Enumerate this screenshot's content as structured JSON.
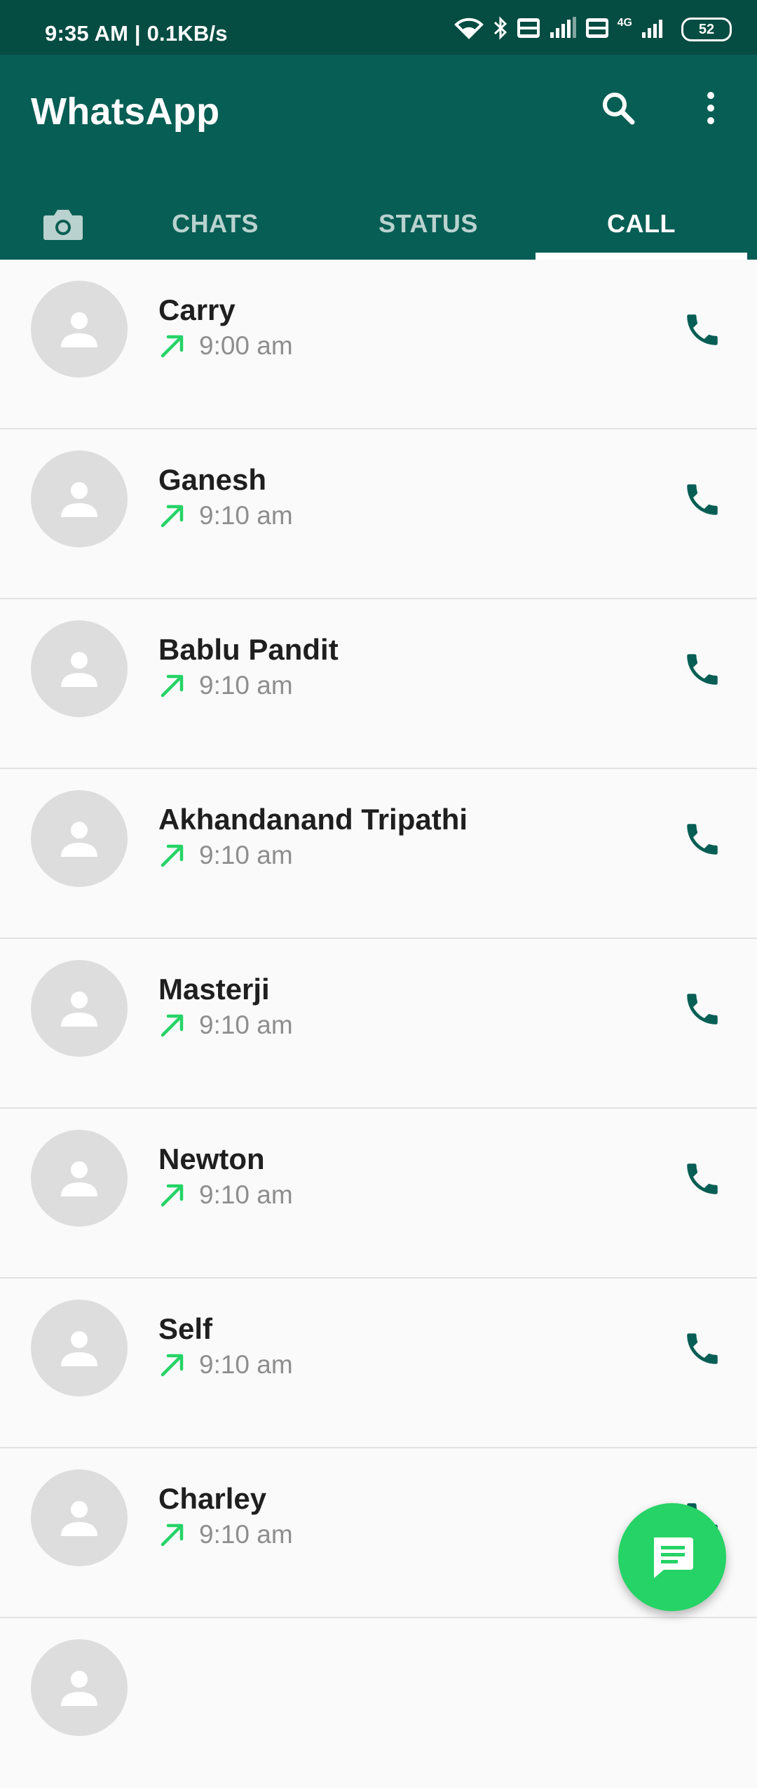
{
  "status_bar": {
    "time_speed": "9:35 AM | 0.1KB/s",
    "network_label": "4G",
    "battery": "52"
  },
  "app_bar": {
    "title": "WhatsApp",
    "tabs": [
      {
        "label": "CHATS",
        "active": false
      },
      {
        "label": "STATUS",
        "active": false
      },
      {
        "label": "CALL",
        "active": true
      }
    ]
  },
  "calls": [
    {
      "name": "Carry",
      "time": "9:00 am",
      "direction": "outgoing-arrow-icon"
    },
    {
      "name": "Ganesh",
      "time": "9:10 am",
      "direction": "outgoing-arrow-icon"
    },
    {
      "name": "Bablu Pandit",
      "time": "9:10 am",
      "direction": "outgoing-arrow-icon"
    },
    {
      "name": "Akhandanand Tripathi",
      "time": "9:10 am",
      "direction": "outgoing-arrow-icon"
    },
    {
      "name": "Masterji",
      "time": "9:10 am",
      "direction": "outgoing-arrow-icon"
    },
    {
      "name": "Newton",
      "time": "9:10 am",
      "direction": "outgoing-arrow-icon"
    },
    {
      "name": "Self",
      "time": "9:10 am",
      "direction": "outgoing-arrow-icon"
    },
    {
      "name": "Charley",
      "time": "9:10 am",
      "direction": "outgoing-arrow-icon"
    }
  ],
  "colors": {
    "status_bar": "#054c42",
    "app_bar": "#075e54",
    "fab": "#25d366",
    "call_icon": "#075e54",
    "outgoing_arrow": "#25d366"
  },
  "icons": {
    "search": "search-icon",
    "menu": "more-vert-icon",
    "camera": "camera-icon",
    "call": "phone-icon",
    "fab": "new-chat-icon"
  }
}
